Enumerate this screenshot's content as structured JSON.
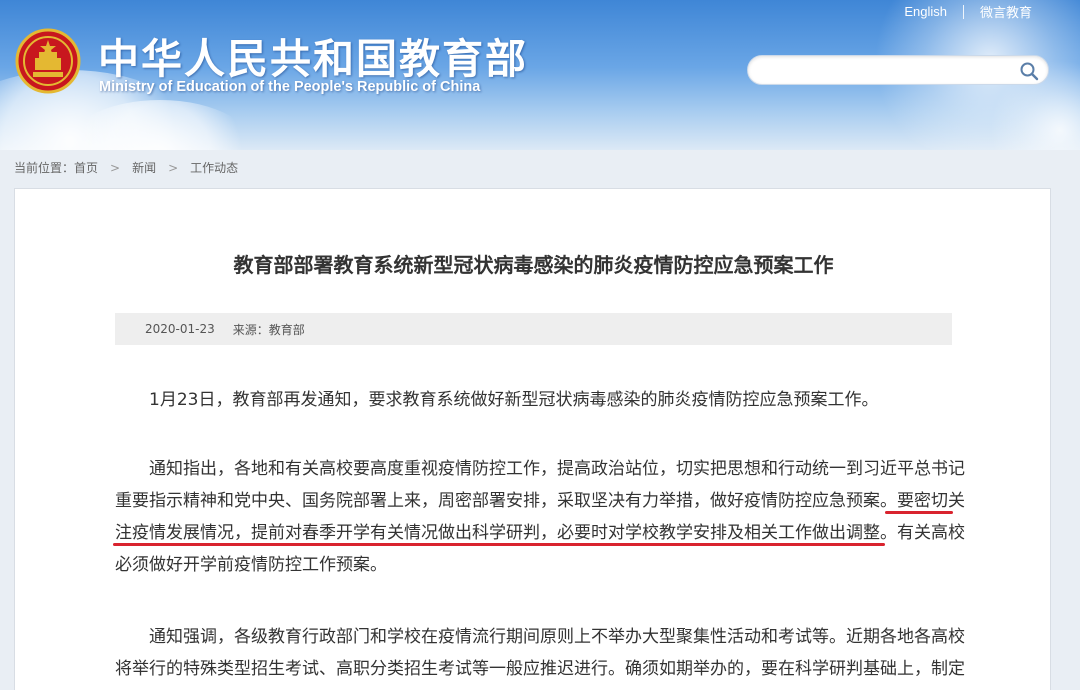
{
  "header": {
    "title_cn": "中华人民共和国教育部",
    "title_en": "Ministry of Education of the People's Republic of China",
    "links": [
      "English",
      "微言教育"
    ],
    "search_placeholder": ""
  },
  "breadcrumb": {
    "prefix": "当前位置：",
    "items": [
      "首页",
      "新闻",
      "工作动态"
    ],
    "separator": ">"
  },
  "article": {
    "title": "教育部部署教育系统新型冠状病毒感染的肺炎疫情防控应急预案工作",
    "date": "2020-01-23",
    "source": "来源：教育部",
    "p1": "1月23日，教育部再发通知，要求教育系统做好新型冠状病毒感染的肺炎疫情防控应急预案工作。",
    "p2_line1": "通知指出，各地和有关高校要高度重视疫情防控工作，提高政治站位，切实把思想和行动统一到习近平总书记",
    "p2_line2_a": "重要指示精神和党中央、国务院部署上来，周密部署安排，采取坚决有力举措，做好疫情防控应急预案。",
    "p2_line2_b": "要密切关",
    "p2_line3_a": "注疫情发展情况，提前对春季开学有关情况做出科学研判，必要时对学校教学安排及相关工作做出调整。",
    "p2_line3_b": "有关高校",
    "p2_line4": "必须做好开学前疫情防控工作预案。",
    "p3_line1": "通知强调，各级教育行政部门和学校在疫情流行期间原则上不举办大型聚集性活动和考试等。近期各地各高校",
    "p3_line2": "将举行的特殊类型招生考试、高职分类招生考试等一般应推迟进行。确须如期举办的，要在科学研判基础上，制定"
  },
  "colors": {
    "header_blue": "#3f86d6",
    "highlight_underline": "#d9232e",
    "page_bg": "#e9eef4"
  },
  "icons": [
    "national-emblem-icon",
    "search-icon"
  ]
}
